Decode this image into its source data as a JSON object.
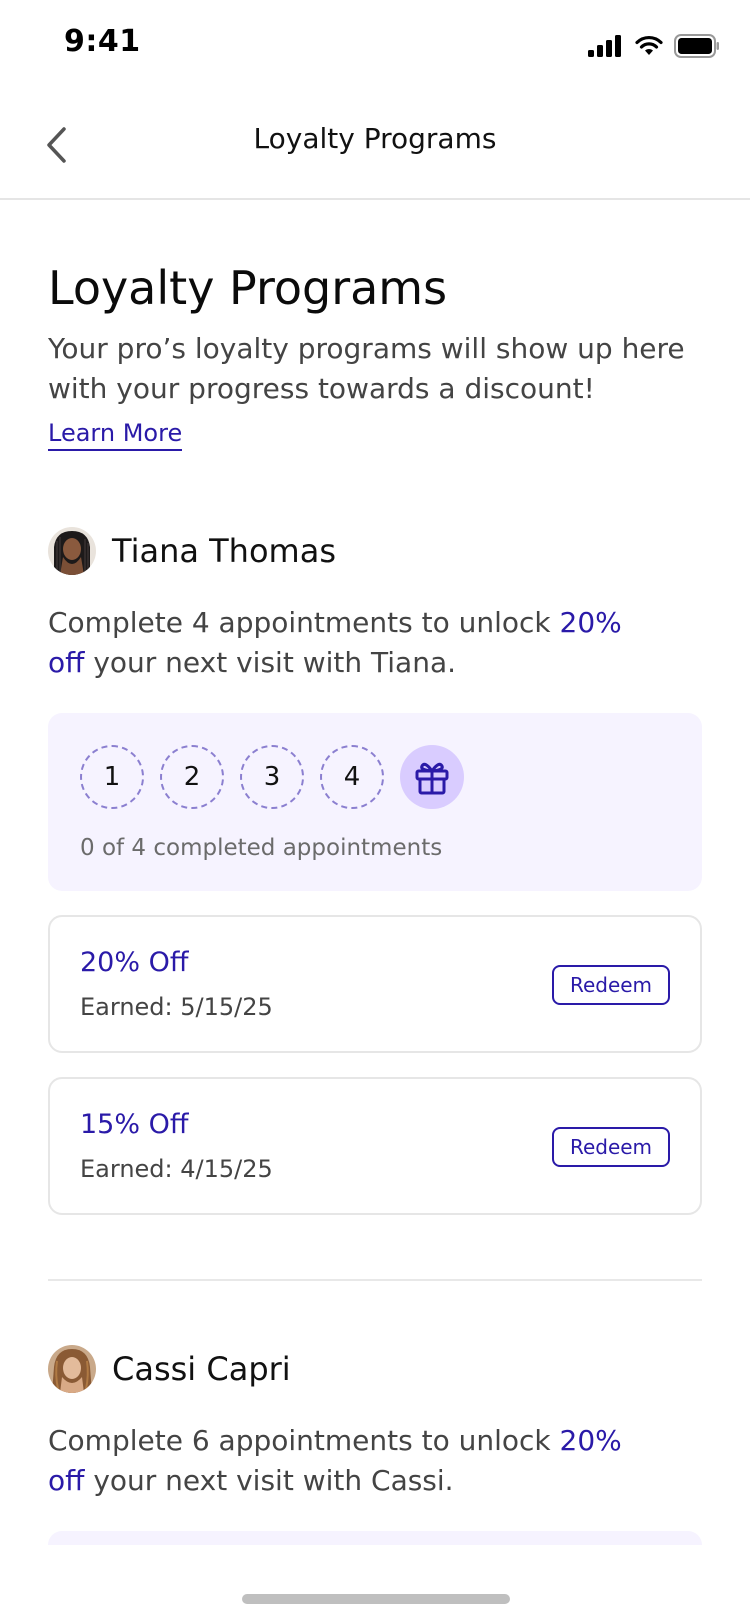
{
  "status_bar": {
    "time": "9:41"
  },
  "nav": {
    "title": "Loyalty Programs"
  },
  "header": {
    "title": "Loyalty Programs",
    "intro": "Your pro’s loyalty programs will show up here with your progress towards a discount!",
    "learn_more": "Learn More"
  },
  "programs": [
    {
      "name": "Tiana Thomas",
      "desc_before": "Complete 4 appointments to unlock ",
      "desc_highlight": "20% off",
      "desc_after": " your next visit with Tiana.",
      "steps": [
        "1",
        "2",
        "3",
        "4"
      ],
      "progress_text": "0 of 4 completed appointments",
      "rewards": [
        {
          "title": "20% Off",
          "earned": "Earned: 5/15/25",
          "button": "Redeem"
        },
        {
          "title": "15% Off",
          "earned": "Earned: 4/15/25",
          "button": "Redeem"
        }
      ]
    },
    {
      "name": "Cassi Capri",
      "desc_before": "Complete 6 appointments to unlock ",
      "desc_highlight": "20% off",
      "desc_after": " your next visit with Cassi."
    }
  ],
  "colors": {
    "accent": "#2a1aa8",
    "card_bg": "#f6f3ff",
    "gift_bg": "#d9ccff"
  },
  "icons": {
    "back": "chevron-left-icon",
    "reward": "gift-icon"
  }
}
